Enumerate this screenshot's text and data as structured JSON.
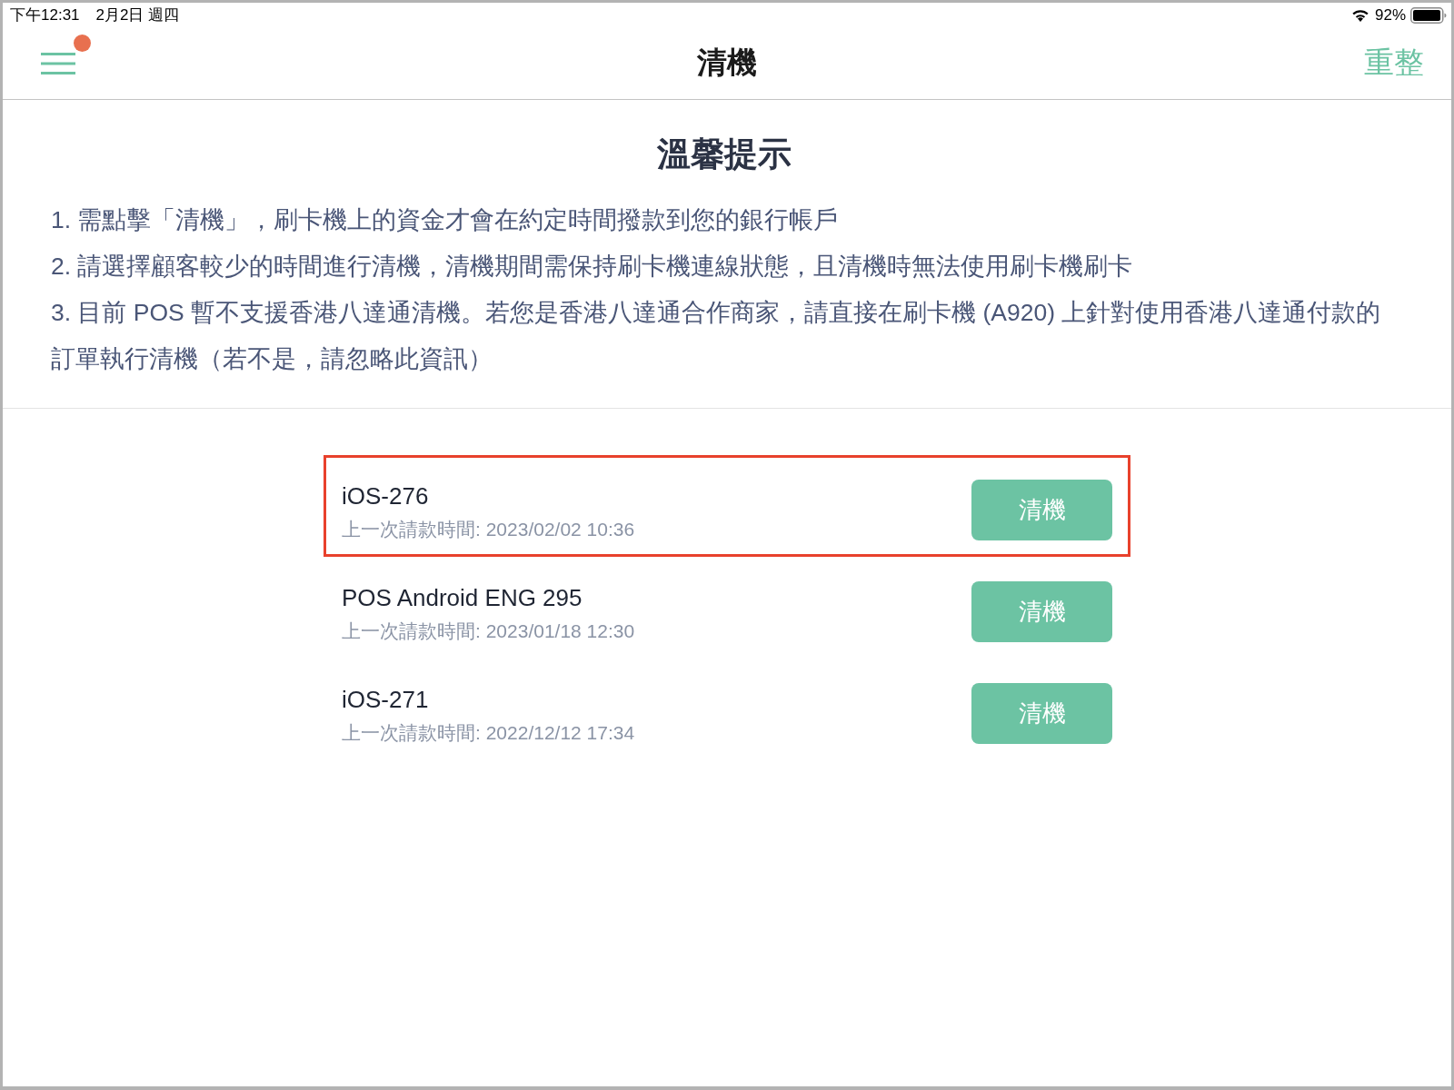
{
  "status_bar": {
    "time": "下午12:31",
    "date": "2月2日 週四",
    "battery": "92%"
  },
  "nav_bar": {
    "menu": {
      "notification": true
    },
    "title": "清機",
    "action": "重整"
  },
  "notice": {
    "title": "溫馨提示",
    "items": [
      "1. 需點擊「清機」，刷卡機上的資金才會在約定時間撥款到您的銀行帳戶",
      "2. 請選擇顧客較少的時間進行清機，清機期間需保持刷卡機連線狀態，且清機時無法使用刷卡機刷卡",
      "3. 目前 POS 暫不支援香港八達通清機。若您是香港八達通合作商家，請直接在刷卡機 (A920) 上針對使用香港八達通付款的訂單執行清機（若不是，請忽略此資訊）"
    ]
  },
  "devices": [
    {
      "name": "iOS-276",
      "last_request": "上一次請款時間: 2023/02/02 10:36",
      "button": "清機",
      "highlighted": true
    },
    {
      "name": "POS Android ENG 295",
      "last_request": "上一次請款時間: 2023/01/18 12:30",
      "button": "清機",
      "highlighted": false
    },
    {
      "name": "iOS-271",
      "last_request": "上一次請款時間: 2022/12/12 17:34",
      "button": "清機",
      "highlighted": false
    }
  ]
}
